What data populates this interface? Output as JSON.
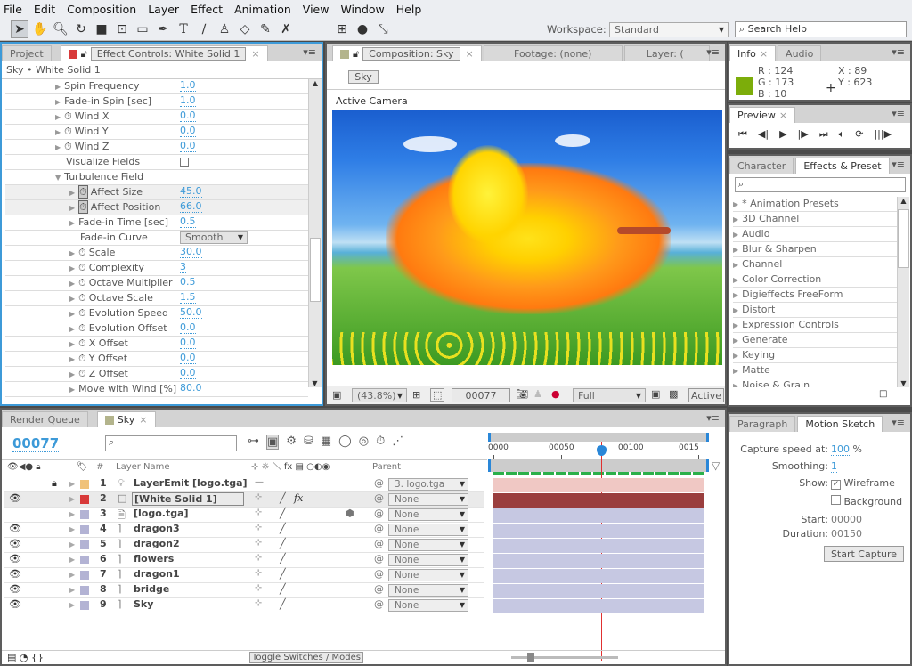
{
  "menu": [
    "File",
    "Edit",
    "Composition",
    "Layer",
    "Effect",
    "Animation",
    "View",
    "Window",
    "Help"
  ],
  "toolbar": {
    "workspace_label": "Workspace:",
    "workspace_value": "Standard",
    "search_placeholder": "Search Help"
  },
  "effect_controls": {
    "tab_project": "Project",
    "tab_title": "Effect Controls: White Solid 1",
    "breadcrumb": "Sky • White Solid 1",
    "properties": [
      {
        "label": "Spin Frequency",
        "value": "1.0",
        "indent": 1,
        "stopwatch": false
      },
      {
        "label": "Fade-in Spin [sec]",
        "value": "1.0",
        "indent": 1,
        "stopwatch": false
      },
      {
        "label": "Wind X",
        "value": "0.0",
        "indent": 1,
        "stopwatch": true
      },
      {
        "label": "Wind Y",
        "value": "0.0",
        "indent": 1,
        "stopwatch": true
      },
      {
        "label": "Wind Z",
        "value": "0.0",
        "indent": 1,
        "stopwatch": true
      },
      {
        "label": "Visualize Fields",
        "value": "",
        "indent": 1,
        "checkbox": true
      },
      {
        "label": "Turbulence Field",
        "value": "",
        "indent": 1,
        "group": true
      },
      {
        "label": "Affect Size",
        "value": "45.0",
        "indent": 2,
        "stopwatch": true,
        "keyed": true
      },
      {
        "label": "Affect Position",
        "value": "66.0",
        "indent": 2,
        "stopwatch": true,
        "keyed": true
      },
      {
        "label": "Fade-in Time [sec]",
        "value": "0.5",
        "indent": 2,
        "stopwatch": false
      },
      {
        "label": "Fade-in Curve",
        "value": "Smooth",
        "indent": 2,
        "dropdown": true
      },
      {
        "label": "Scale",
        "value": "30.0",
        "indent": 2,
        "stopwatch": true
      },
      {
        "label": "Complexity",
        "value": "3",
        "indent": 2,
        "stopwatch": true
      },
      {
        "label": "Octave Multiplier",
        "value": "0.5",
        "indent": 2,
        "stopwatch": true
      },
      {
        "label": "Octave Scale",
        "value": "1.5",
        "indent": 2,
        "stopwatch": true
      },
      {
        "label": "Evolution Speed",
        "value": "50.0",
        "indent": 2,
        "stopwatch": true
      },
      {
        "label": "Evolution Offset",
        "value": "0.0",
        "indent": 2,
        "stopwatch": true
      },
      {
        "label": "X Offset",
        "value": "0.0",
        "indent": 2,
        "stopwatch": true
      },
      {
        "label": "Y Offset",
        "value": "0.0",
        "indent": 2,
        "stopwatch": true
      },
      {
        "label": "Z Offset",
        "value": "0.0",
        "indent": 2,
        "stopwatch": true
      },
      {
        "label": "Move with Wind [%]",
        "value": "80.0",
        "indent": 2,
        "stopwatch": false
      }
    ]
  },
  "composition": {
    "tab_title": "Composition: Sky",
    "tab_footage": "Footage: (none)",
    "tab_layer": "Layer: (",
    "breadcrumb": "Sky",
    "camera": "Active Camera",
    "zoom": "(43.8%)",
    "timecode": "00077",
    "resolution": "Full",
    "view": "Active"
  },
  "info": {
    "tab": "Info",
    "tab_audio": "Audio",
    "r": "R : 124",
    "g": "G : 173",
    "b": "B : 10",
    "x": "X : 89",
    "y": "Y : 623",
    "swatch": "#7cad0a"
  },
  "preview": {
    "tab": "Preview"
  },
  "effects_presets": {
    "tab_character": "Character",
    "tab": "Effects & Preset",
    "items": [
      "* Animation Presets",
      "3D Channel",
      "Audio",
      "Blur & Sharpen",
      "Channel",
      "Color Correction",
      "Digieffects FreeForm",
      "Distort",
      "Expression Controls",
      "Generate",
      "Keying",
      "Matte",
      "Noise & Grain"
    ]
  },
  "motion_sketch": {
    "tab_paragraph": "Paragraph",
    "tab": "Motion Sketch",
    "capture_label": "Capture speed at:",
    "capture_value": "100",
    "capture_unit": "%",
    "smoothing_label": "Smoothing:",
    "smoothing_value": "1",
    "show_label": "Show:",
    "wireframe": "Wireframe",
    "wireframe_checked": true,
    "background": "Background",
    "background_checked": false,
    "start_label": "Start:",
    "start_value": "00000",
    "duration_label": "Duration:",
    "duration_value": "00150",
    "button": "Start Capture"
  },
  "timeline": {
    "tab_render": "Render Queue",
    "tab_comp": "Sky",
    "timecode": "00077",
    "col_num": "#",
    "col_name": "Layer Name",
    "col_parent": "Parent",
    "ruler": [
      "0000",
      "00050",
      "00100",
      "0015"
    ],
    "toggle": "Toggle Switches / Modes",
    "layers": [
      {
        "num": "1",
        "name": "LayerEmit [logo.tga]",
        "color": "#f0c27a",
        "parent": "3. logo.tga",
        "visible": false,
        "bar": "#f0c8c4",
        "locked": true
      },
      {
        "num": "2",
        "name": "[White Solid 1]",
        "color": "#d83a3a",
        "parent": "None",
        "visible": true,
        "bar": "#9a3e3e",
        "fx": true
      },
      {
        "num": "3",
        "name": "[logo.tga]",
        "color": "#b3b3d4",
        "parent": "None",
        "visible": false,
        "bar": "#c6c8e2"
      },
      {
        "num": "4",
        "name": "dragon3",
        "color": "#b3b3d4",
        "parent": "None",
        "visible": true,
        "bar": "#c6c8e2"
      },
      {
        "num": "5",
        "name": "dragon2",
        "color": "#b3b3d4",
        "parent": "None",
        "visible": true,
        "bar": "#c6c8e2"
      },
      {
        "num": "6",
        "name": "flowers",
        "color": "#b3b3d4",
        "parent": "None",
        "visible": true,
        "bar": "#c6c8e2"
      },
      {
        "num": "7",
        "name": "dragon1",
        "color": "#b3b3d4",
        "parent": "None",
        "visible": true,
        "bar": "#c6c8e2"
      },
      {
        "num": "8",
        "name": "bridge",
        "color": "#b3b3d4",
        "parent": "None",
        "visible": true,
        "bar": "#c6c8e2"
      },
      {
        "num": "9",
        "name": "Sky",
        "color": "#b3b3d4",
        "parent": "None",
        "visible": true,
        "bar": "#c6c8e2"
      }
    ]
  },
  "colors": {
    "accent": "#3d9ad8",
    "playhead": "#e03030"
  }
}
